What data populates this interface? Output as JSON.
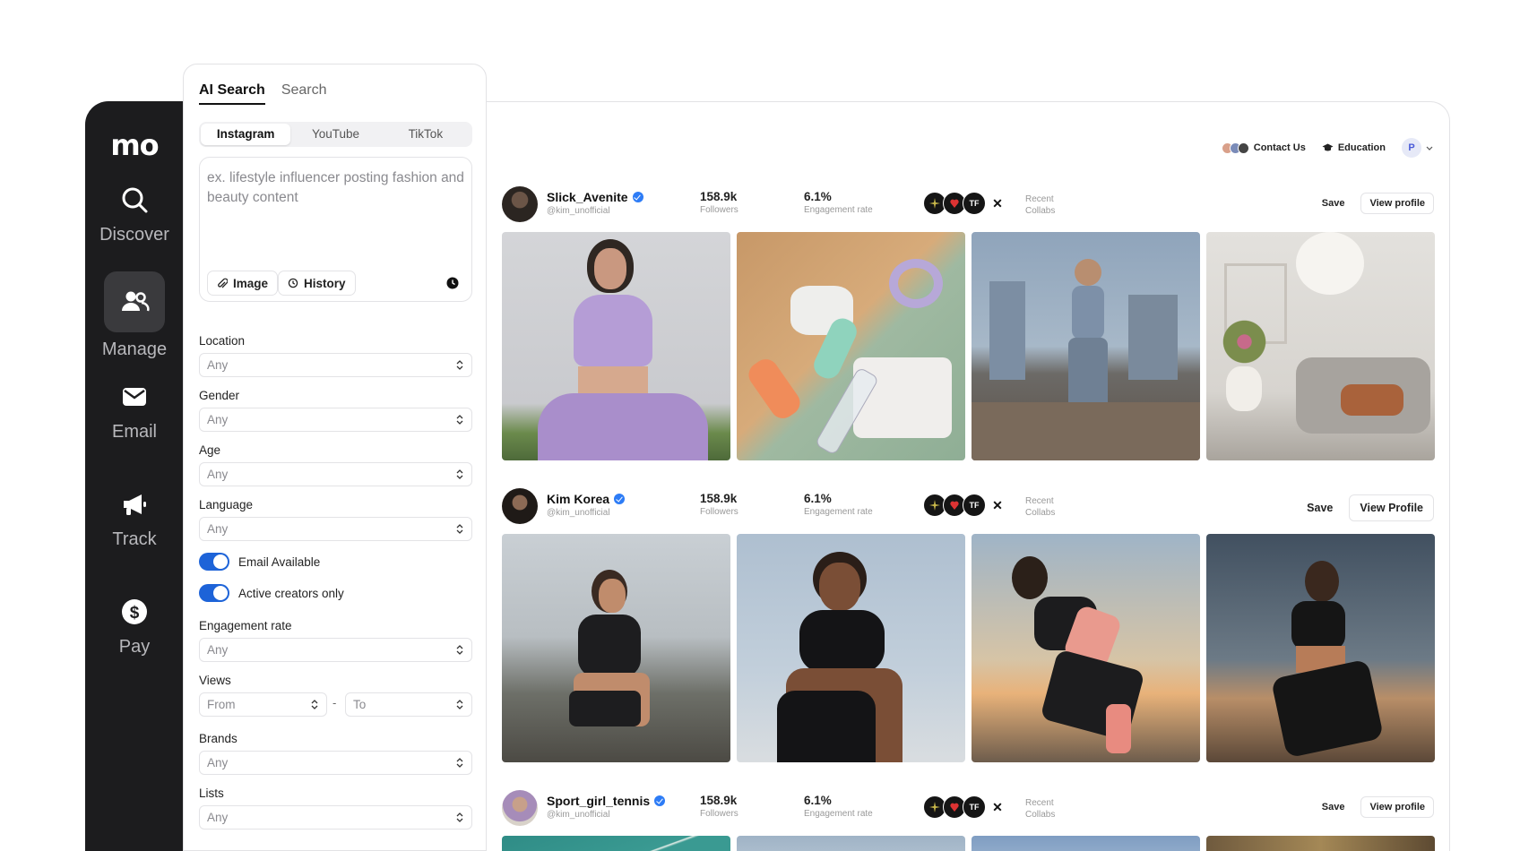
{
  "sidebar": {
    "logo": "mo",
    "items": [
      {
        "label": "Discover",
        "icon": "search-icon"
      },
      {
        "label": "Manage",
        "icon": "users-icon",
        "active": true
      },
      {
        "label": "Email",
        "icon": "mail-icon"
      },
      {
        "label": "Track",
        "icon": "megaphone-icon"
      },
      {
        "label": "Pay",
        "icon": "dollar-icon"
      }
    ]
  },
  "panel": {
    "tabs": [
      "AI Search",
      "Search"
    ],
    "platforms": [
      "Instagram",
      "YouTube",
      "TikTok"
    ],
    "query_placeholder": "ex. lifestyle influencer posting fashion and beauty content",
    "image_button": "Image",
    "history_button": "History",
    "filters": {
      "location": {
        "label": "Location",
        "value": "Any"
      },
      "gender": {
        "label": "Gender",
        "value": "Any"
      },
      "age": {
        "label": "Age",
        "value": "Any"
      },
      "language": {
        "label": "Language",
        "value": "Any"
      },
      "engagement": {
        "label": "Engagement rate",
        "value": "Any"
      },
      "views": {
        "label": "Views",
        "from": "From",
        "to": "To",
        "sep": "-"
      },
      "brands": {
        "label": "Brands",
        "value": "Any"
      },
      "lists": {
        "label": "Lists",
        "value": "Any"
      }
    },
    "toggles": [
      {
        "label": "Email Available",
        "on": true
      },
      {
        "label": "Active creators only",
        "on": true
      }
    ]
  },
  "topbar": {
    "contact": "Contact Us",
    "education": "Education",
    "user_initial": "P"
  },
  "creators": [
    {
      "name": "Slick_Avenite",
      "handle": "@kim_unofficial",
      "followers": "158.9k",
      "followers_label": "Followers",
      "engagement": "6.1%",
      "engagement_label": "Engagement rate",
      "recent_label_1": "Recent",
      "recent_label_2": "Collabs",
      "save": "Save",
      "view": "View profile"
    },
    {
      "name": "Kim Korea",
      "handle": "@kim_unofficial",
      "followers": "158.9k",
      "followers_label": "Followers",
      "engagement": "6.1%",
      "engagement_label": "Engagement rate",
      "recent_label_1": "Recent",
      "recent_label_2": "Collabs",
      "save": "Save",
      "view": "View Profile"
    },
    {
      "name": "Sport_girl_tennis",
      "handle": "@kim_unofficial",
      "followers": "158.9k",
      "followers_label": "Followers",
      "engagement": "6.1%",
      "engagement_label": "Engagement rate",
      "recent_label_1": "Recent",
      "recent_label_2": "Collabs",
      "save": "Save",
      "view": "View profile"
    }
  ],
  "brand_marks": [
    "TF"
  ],
  "colors": {
    "rail": "#1c1c1e",
    "accent": "#1d63d8",
    "verified": "#2d7cf6"
  }
}
